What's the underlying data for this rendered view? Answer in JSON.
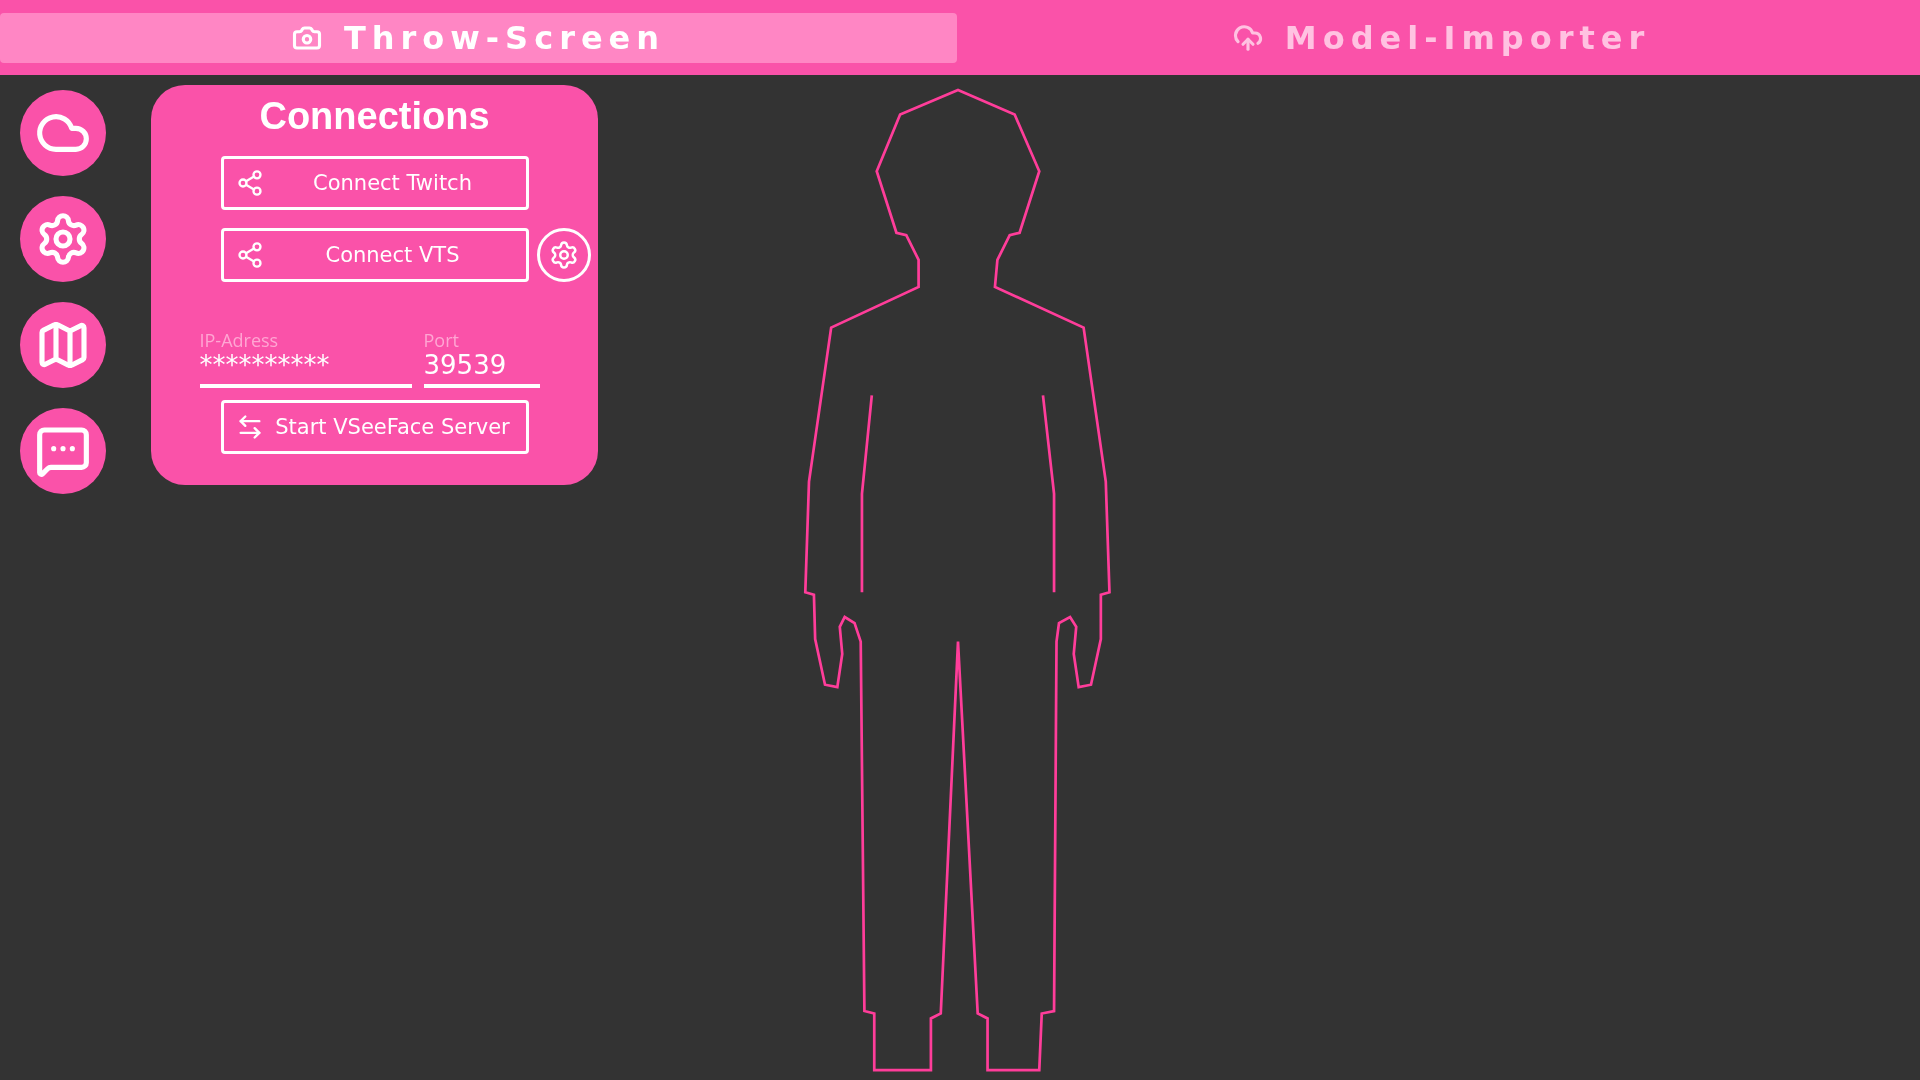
{
  "tabs": [
    {
      "label": "Throw-Screen",
      "selected": true
    },
    {
      "label": "Model-Importer",
      "selected": false
    }
  ],
  "panel": {
    "title": "Connections",
    "buttons": [
      {
        "label": "Connect Twitch",
        "kind": "plain"
      },
      {
        "label": "Connect VTS",
        "kind": "configurable"
      }
    ],
    "fields": [
      {
        "label": "IP-Adress",
        "value": "**********"
      },
      {
        "label": "Port",
        "value": "39539"
      }
    ],
    "action": {
      "label": "Start VSeeFace Server"
    }
  }
}
